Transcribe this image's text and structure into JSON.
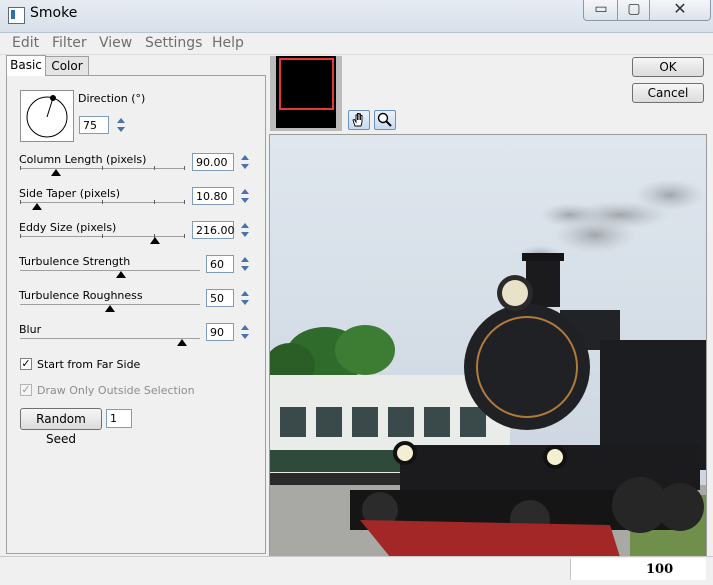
{
  "window": {
    "title": "Smoke",
    "minimize_glyph": "▭",
    "maximize_glyph": "▢",
    "close_glyph": "✕"
  },
  "menu": [
    "Edit",
    "Filter",
    "View",
    "Settings",
    "Help"
  ],
  "tabs": {
    "basic": "Basic",
    "color": "Color"
  },
  "direction": {
    "label": "Direction (°)",
    "value": "75"
  },
  "sliders": [
    {
      "label": "Column Length (pixels)",
      "value": "90.00",
      "fraction": 0.22
    },
    {
      "label": "Side Taper (pixels)",
      "value": "10.80",
      "fraction": 0.1
    },
    {
      "label": "Eddy Size (pixels)",
      "value": "216.00",
      "fraction": 0.82
    },
    {
      "label": "Turbulence Strength",
      "value": "60",
      "fraction": 0.56
    },
    {
      "label": "Turbulence Roughness",
      "value": "50",
      "fraction": 0.5
    },
    {
      "label": "Blur",
      "value": "90",
      "fraction": 0.9
    }
  ],
  "options": {
    "start_far_side": {
      "label": "Start from Far Side",
      "checked": true
    },
    "draw_outside": {
      "label": "Draw Only Outside Selection",
      "checked": true,
      "disabled": true
    }
  },
  "random_seed": {
    "label": "Random Seed",
    "value": "1"
  },
  "buttons": {
    "ok": "OK",
    "cancel": "Cancel"
  },
  "tools": {
    "pan": "hand-icon",
    "zoom": "magnifier-icon"
  },
  "status": {
    "zoom": "100"
  }
}
